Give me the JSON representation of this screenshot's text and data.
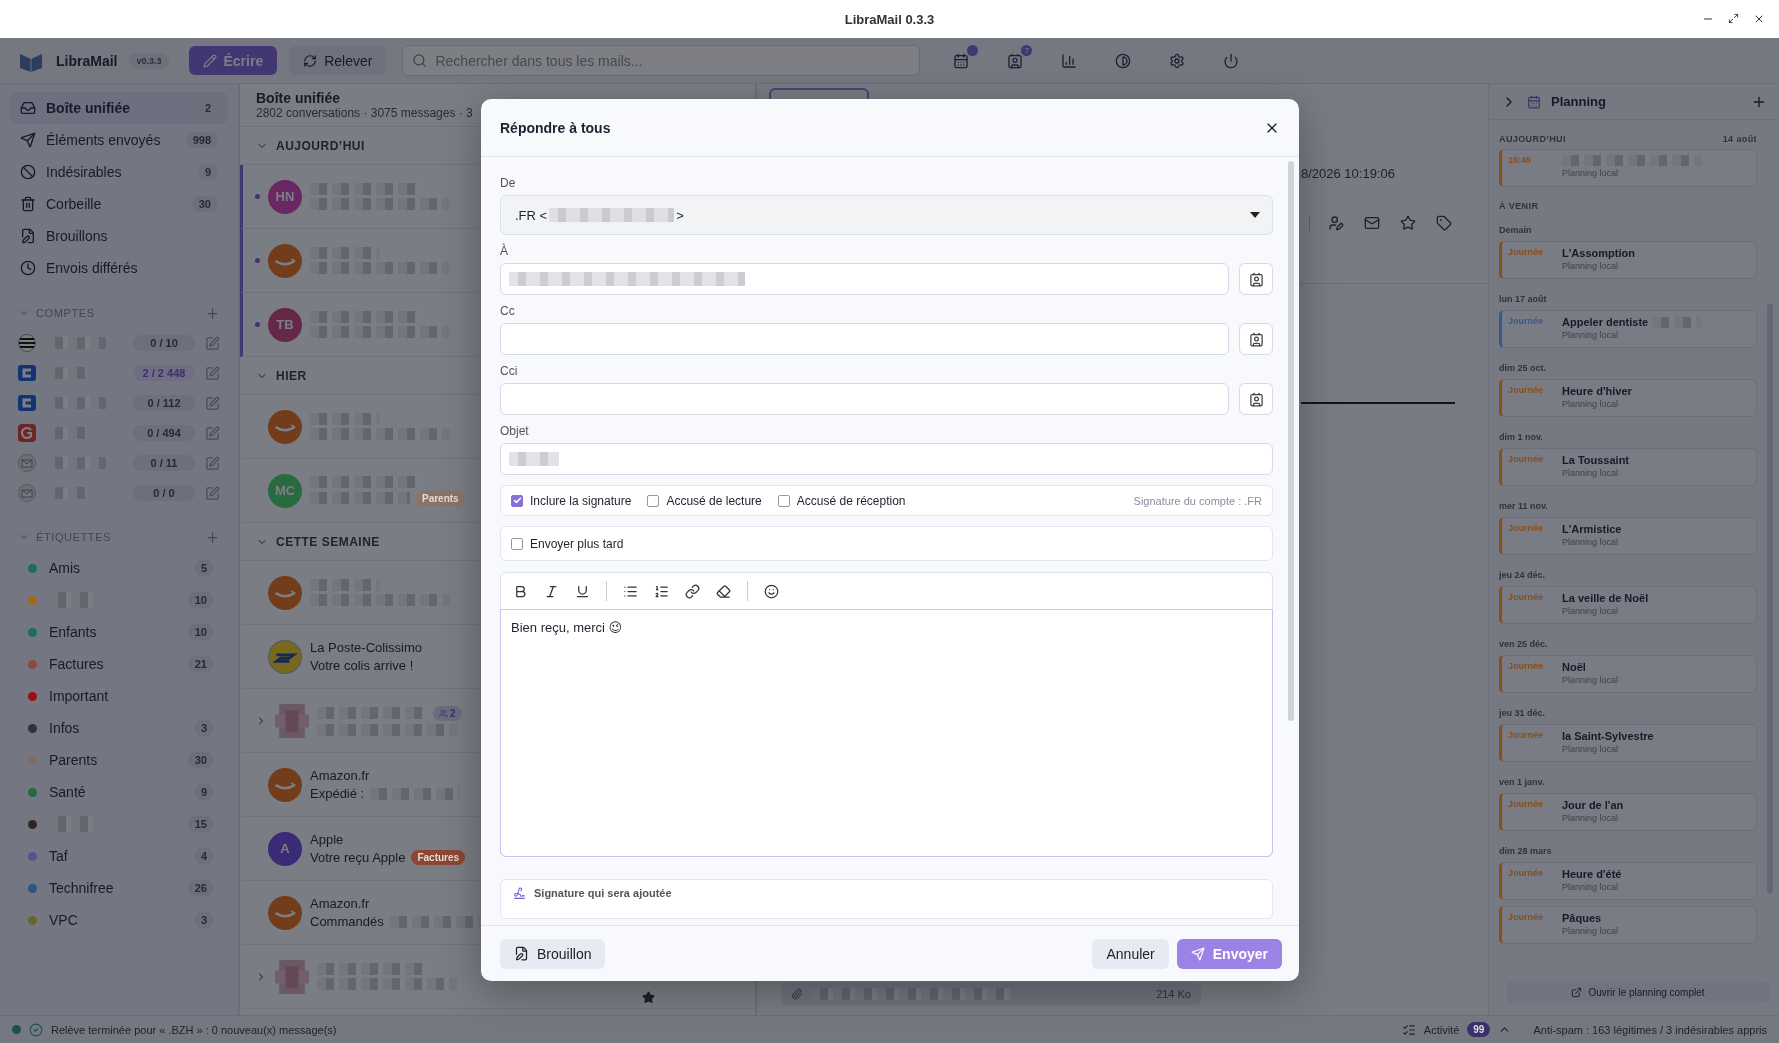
{
  "window": {
    "title": "LibraMail 0.3.3"
  },
  "toolbar": {
    "app_name": "LibraMail",
    "version": "v0.3.3",
    "compose": "Écrire",
    "fetch": "Relever",
    "search": {
      "placeholder": "Rechercher dans tous les mails..."
    },
    "icons": [
      {
        "kind": "calendar",
        "dot": true
      },
      {
        "kind": "contacts",
        "badge": "7"
      },
      {
        "kind": "stats"
      },
      {
        "kind": "theme"
      },
      {
        "kind": "settings"
      },
      {
        "kind": "power"
      }
    ]
  },
  "sidebar": {
    "folders": [
      {
        "kind": "inbox",
        "label": "Boîte unifiée",
        "count": "2",
        "selected": true
      },
      {
        "kind": "sent",
        "label": "Éléments envoyés",
        "count": "998",
        "selected": false
      },
      {
        "kind": "spam",
        "label": "Indésirables",
        "count": "9",
        "selected": false
      },
      {
        "kind": "trash",
        "label": "Corbeille",
        "count": "30",
        "selected": false
      },
      {
        "kind": "drafts",
        "label": "Brouillons",
        "selected": false
      },
      {
        "kind": "scheduled",
        "label": "Envois différés",
        "selected": false
      }
    ],
    "accounts_section": {
      "title": "COMPTES",
      "expanded": true
    },
    "accounts": [
      {
        "kind": "flag",
        "count": "0 / 10",
        "unread": false
      },
      {
        "kind": "c",
        "count": "2 / 2 448",
        "unread": true
      },
      {
        "kind": "c",
        "count": "0 / 112",
        "unread": false
      },
      {
        "kind": "google",
        "count": "0 / 494",
        "unread": false
      },
      {
        "kind": "mail",
        "count": "0 / 11",
        "unread": false
      },
      {
        "kind": "mail",
        "count": "0 / 0",
        "unread": false
      }
    ],
    "labels_section": {
      "title": "ÉTIQUETTES",
      "expanded": true
    },
    "labels": [
      {
        "name": "Amis",
        "count": "5",
        "color": "#1e6b66"
      },
      {
        "count": "10",
        "color": "#a0681c"
      },
      {
        "name": "Enfants",
        "count": "10",
        "color": "#1e6b67"
      },
      {
        "name": "Factures",
        "count": "21",
        "color": "#8a4c3a"
      },
      {
        "name": "Important",
        "color": "#9c0e12"
      },
      {
        "name": "Infos",
        "count": "3",
        "color": "#2e323c"
      },
      {
        "name": "Parents",
        "count": "30",
        "color": "#7d6c66"
      },
      {
        "name": "Santé",
        "count": "9",
        "color": "#236a40"
      },
      {
        "count": "15",
        "color": "#2e2420"
      },
      {
        "name": "Taf",
        "count": "4",
        "color": "#5c4f94"
      },
      {
        "name": "Technifree",
        "count": "26",
        "color": "#2d5488"
      },
      {
        "name": "VPC",
        "count": "3",
        "color": "#66652c"
      }
    ]
  },
  "mail_list": {
    "title": "Boîte unifiée",
    "summary": "2802 conversations · 3075 messages · 3",
    "groups": [
      {
        "title": "AUJOURD’HUI",
        "expanded": true,
        "rows": [
          {
            "kind": "initials",
            "initials": "HN",
            "color": "#6a2862",
            "unread": true
          },
          {
            "kind": "amazon",
            "unread": true
          },
          {
            "kind": "initials",
            "initials": "TB",
            "color": "#662848",
            "unread": true
          }
        ]
      },
      {
        "title": "HIER",
        "expanded": true,
        "rows": [
          {
            "kind": "amazon",
            "unread": false
          },
          {
            "kind": "initials",
            "initials": "MC",
            "color": "#276b3e",
            "unread": false,
            "tag": {
              "label": "Parents",
              "color": "#8a7366"
            }
          }
        ]
      },
      {
        "title": "CETTE SEMAINE",
        "expanded": true,
        "rows": [
          {
            "kind": "amazon",
            "unread": false
          },
          {
            "kind": "laposte",
            "sender": "La Poste-Colissimo",
            "subject": "Votre colis arrive !",
            "unread": false
          },
          {
            "kind": "thread",
            "expanded": false,
            "count": "2",
            "unread": false
          },
          {
            "kind": "amazon",
            "sender": "Amazon.fr",
            "subject": "Expédié :",
            "redacted_tail": true,
            "unread": false
          },
          {
            "kind": "initials",
            "initials": "A",
            "color": "#3a2a78",
            "sender": "Apple",
            "subject": "Votre reçu Apple",
            "unread": false,
            "tag": {
              "label": "Factures",
              "color": "#8e4634"
            }
          },
          {
            "kind": "amazon",
            "sender": "Amazon.fr",
            "subject": "Commandés",
            "redacted_tail": true,
            "unread": false
          },
          {
            "kind": "thread",
            "expanded": false,
            "unread": false,
            "starred": true
          }
        ]
      }
    ]
  },
  "reader": {
    "date": "8/2026 10:19:06",
    "attachment_size": "214 Ko"
  },
  "planning": {
    "title": "Planning",
    "today": {
      "label": "AUJOURD’HUI",
      "date": "14 août",
      "events": [
        {
          "time": "15:45",
          "source": "Planning local",
          "color": "#8a4e1a",
          "redacted": true
        }
      ]
    },
    "upcoming": {
      "label": "À VENIR",
      "days": [
        {
          "date": "Demain",
          "events": [
            {
              "time": "Journée",
              "title": "L'Assomption",
              "source": "Planning local",
              "color": "#8a4e1a"
            }
          ]
        },
        {
          "date": "lun 17 août",
          "events": [
            {
              "time": "Journée",
              "title": "Appeler dentiste",
              "source": "Planning local",
              "color": "#355a8a",
              "redacted": true
            }
          ]
        },
        {
          "date": "dim 25 oct.",
          "events": [
            {
              "time": "Journée",
              "title": "Heure d'hiver",
              "source": "Planning local",
              "color": "#8a4e1a"
            }
          ]
        },
        {
          "date": "dim 1 nov.",
          "events": [
            {
              "time": "Journée",
              "title": "La Toussaint",
              "source": "Planning local",
              "color": "#8a4e1a"
            }
          ]
        },
        {
          "date": "mer 11 nov.",
          "events": [
            {
              "time": "Journée",
              "title": "L'Armistice",
              "source": "Planning local",
              "color": "#8a4e1a"
            }
          ]
        },
        {
          "date": "jeu 24 déc.",
          "events": [
            {
              "time": "Journée",
              "title": "La veille de Noël",
              "source": "Planning local",
              "color": "#8a4e1a"
            }
          ]
        },
        {
          "date": "ven 25 déc.",
          "events": [
            {
              "time": "Journée",
              "title": "Noël",
              "source": "Planning local",
              "color": "#8a4e1a"
            }
          ]
        },
        {
          "date": "jeu 31 déc.",
          "events": [
            {
              "time": "Journée",
              "title": "la Saint-Sylvestre",
              "source": "Planning local",
              "color": "#8a4e1a"
            }
          ]
        },
        {
          "date": "ven 1 janv.",
          "events": [
            {
              "time": "Journée",
              "title": "Jour de l'an",
              "source": "Planning local",
              "color": "#8a4e1a"
            }
          ]
        },
        {
          "date": "dim 28 mars",
          "events": [
            {
              "time": "Journée",
              "title": "Heure d'été",
              "source": "Planning local",
              "color": "#8a4e1a"
            },
            {
              "time": "Journée",
              "title": "Pâques",
              "source": "Planning local",
              "color": "#8a4e1a"
            }
          ]
        }
      ]
    },
    "open_button": "Ouvrir le planning complet"
  },
  "status_bar": {
    "message": "Relève terminée pour « .BZH » : 0 nouveau(x) message(s)",
    "activity": "Activité",
    "activity_count": "99",
    "antispam": "Anti-spam : 163 légitimes / 3 indésirables appris"
  },
  "modal": {
    "title": "Répondre à tous",
    "from": {
      "label": "De",
      "prefix": ".FR <",
      "suffix": ">"
    },
    "recipients": [
      {
        "label": "À",
        "redacted": true
      },
      {
        "label": "Cc",
        "redacted": false
      },
      {
        "label": "Cci",
        "redacted": false
      }
    ],
    "subject": {
      "label": "Objet",
      "redacted": true
    },
    "options": [
      {
        "label": "Inclure la signature",
        "checked": true
      },
      {
        "label": "Accusé de lecture",
        "checked": false
      },
      {
        "label": "Accusé de réception",
        "checked": false
      }
    ],
    "signature_note": "Signature du compte : .FR",
    "send_later": {
      "label": "Envoyer plus tard",
      "checked": false
    },
    "editor_tools": [
      {
        "kind": "bold"
      },
      {
        "kind": "italic"
      },
      {
        "kind": "underline"
      },
      {
        "kind": "separator"
      },
      {
        "kind": "bullets"
      },
      {
        "kind": "numbers"
      },
      {
        "kind": "link"
      },
      {
        "kind": "eraser"
      },
      {
        "kind": "separator"
      },
      {
        "kind": "emoji"
      }
    ],
    "body": "Bien reçu, merci 😉",
    "signature_section": "Signature qui sera ajoutée",
    "buttons": {
      "draft": "Brouillon",
      "cancel": "Annuler",
      "send": "Envoyer"
    }
  }
}
